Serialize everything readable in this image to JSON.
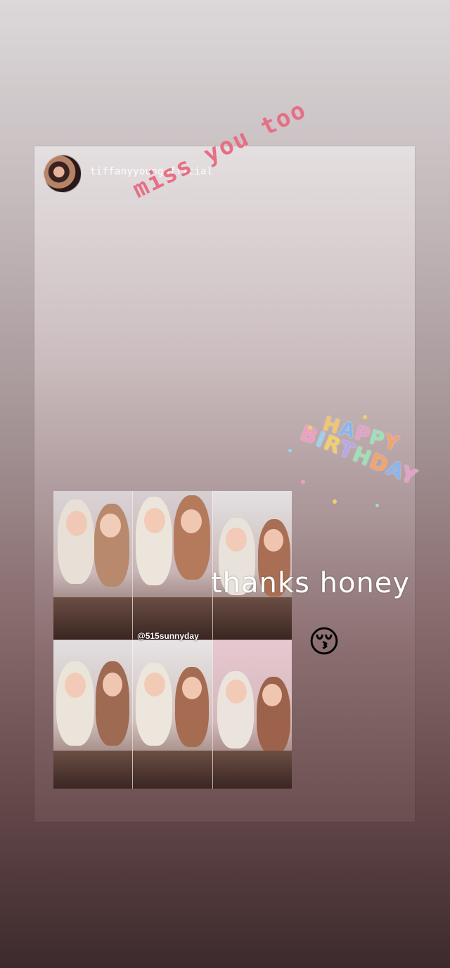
{
  "story": {
    "shared_post": {
      "username": "tiffanyyoungofficial",
      "watermark": "@515sunnyday"
    },
    "stickers": {
      "miss_you_too": "miss you too",
      "happy": "HAPPY",
      "birthday": "BIRTHDAY",
      "thanks_honey": "thanks honey",
      "emoji": "😚",
      "emoji_name": "kissing-face-smiling-eyes"
    },
    "colors": {
      "miss_you_too": "#e66f86",
      "happy_letters": [
        "#f1c76a",
        "#8ab6f0",
        "#e5a1c9",
        "#9ee0b7",
        "#f4a36b"
      ],
      "birthday_letters": [
        "#f19dc1",
        "#9fd0f1",
        "#f3cf6a",
        "#b8a5f0",
        "#9ee0b7",
        "#f4a36b",
        "#8ab6f0",
        "#e5a1c9"
      ]
    }
  }
}
